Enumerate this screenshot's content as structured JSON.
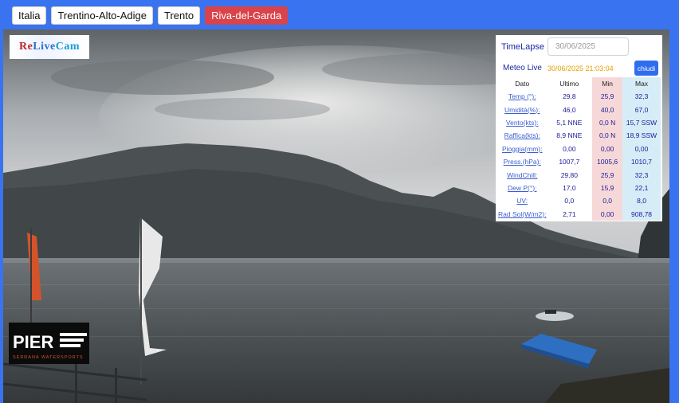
{
  "breadcrumbs": [
    {
      "label": "Italia",
      "active": false
    },
    {
      "label": "Trentino-Alto-Adige",
      "active": false
    },
    {
      "label": "Trento",
      "active": false
    },
    {
      "label": "Riva-del-Garda",
      "active": true
    }
  ],
  "logos": {
    "relive": {
      "part1": "Re",
      "part2": "Live",
      "part3": "Cam"
    },
    "pier": {
      "name": "PIER",
      "tagline": "SERRANA WATERSPORTS"
    }
  },
  "meteo": {
    "timelapse_label": "TimeLapse",
    "timelapse_date": "30/06/2025",
    "live_label": "Meteo Live",
    "live_timestamp": "30/06/2025 21:03:04",
    "close_label": "chiudi",
    "headers": [
      "Dato",
      "Ultimo",
      "Min",
      "Max"
    ],
    "rows": [
      {
        "name": "Temp (°):",
        "last": "29,8",
        "min": "25,9",
        "max": "32,3"
      },
      {
        "name": "Umidità(%):",
        "last": "46,0",
        "min": "40,0",
        "max": "67,0"
      },
      {
        "name": "Vento(kts):",
        "last": "5,1 NNE",
        "min": "0,0 N",
        "max": "15,7 SSW"
      },
      {
        "name": "Raffica(kts):",
        "last": "8,9 NNE",
        "min": "0,0 N",
        "max": "18,9 SSW"
      },
      {
        "name": "Pioggia(mm):",
        "last": "0,00",
        "min": "0,00",
        "max": "0,00"
      },
      {
        "name": "Press.(hPa):",
        "last": "1007,7",
        "min": "1005,6",
        "max": "1010,7"
      },
      {
        "name": "WindChill:",
        "last": "29,80",
        "min": "25,9",
        "max": "32,3"
      },
      {
        "name": "Dew P(°):",
        "last": "17,0",
        "min": "15,9",
        "max": "22,1"
      },
      {
        "name": "UV:",
        "last": "0,0",
        "min": "0,0",
        "max": "8,0"
      },
      {
        "name": "Rad Sol(W/m2):",
        "last": "2,71",
        "min": "0,00",
        "max": "908,78"
      }
    ]
  },
  "colors": {
    "background": "#3a73f0",
    "active_crumb": "#d9434a",
    "accent_button": "#2f6df0",
    "timestamp": "#e3a300",
    "min_col": "#f7d8d8",
    "max_col": "#d6ecf6"
  }
}
